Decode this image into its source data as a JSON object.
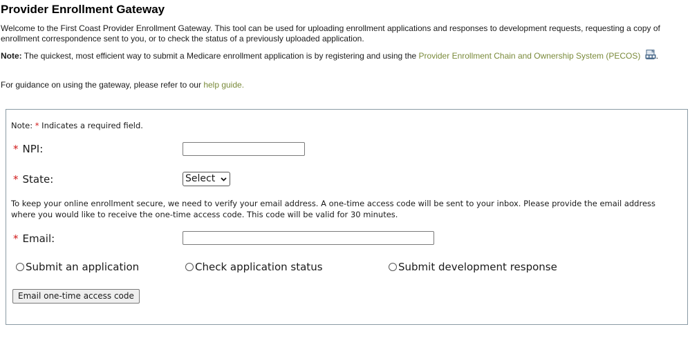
{
  "page": {
    "title": "Provider Enrollment Gateway",
    "intro": "Welcome to the First Coast Provider Enrollment Gateway. This tool can be used for uploading enrollment applications and responses to development requests, requesting a copy of enrollment correspondence sent to you, or to check the status of a previously uploaded application.",
    "note_label": "Note:",
    "note_text": "The quickest, most efficient way to submit a Medicare enrollment application is by registering and using the",
    "pecos_link": "Provider Enrollment Chain and Ownership System (PECOS)",
    "note_end": ".",
    "guide_text": "For guidance on using the gateway, please refer to our",
    "guide_link": "help guide."
  },
  "form": {
    "required_note_prefix": "Note:",
    "required_star": "*",
    "required_note_suffix": "Indicates a required field.",
    "npi_label": "NPI:",
    "npi_value": "",
    "state_label": "State:",
    "state_selected": "Select",
    "verify_text": "To keep your online enrollment secure, we need to verify your email address. A one-time access code will be sent to your inbox. Please provide the email address where you would like to receive the one-time access code. This code will be valid for 30 minutes.",
    "email_label": "Email:",
    "email_value": "",
    "radio_options": [
      "Submit an application",
      "Check application status",
      "Submit development response"
    ],
    "submit_label": "Email one-time access code"
  },
  "icons": {
    "pdf": "pdf-icon"
  }
}
